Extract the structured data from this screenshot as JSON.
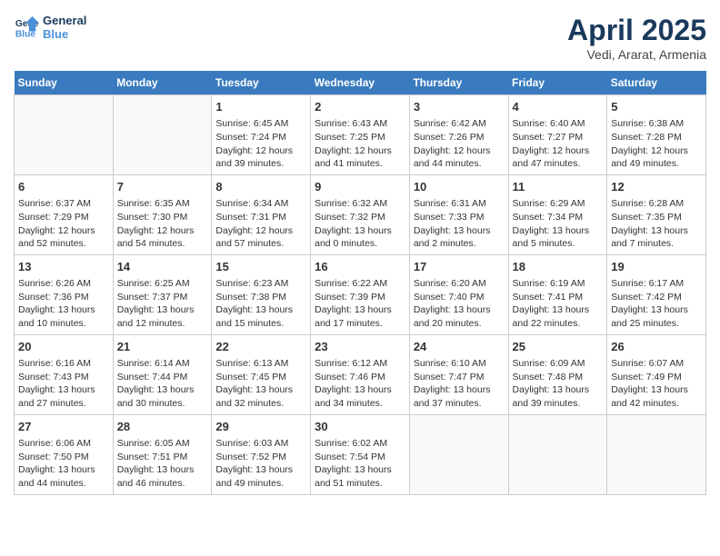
{
  "header": {
    "logo_line1": "General",
    "logo_line2": "Blue",
    "month_title": "April 2025",
    "location": "Vedi, Ararat, Armenia"
  },
  "days_of_week": [
    "Sunday",
    "Monday",
    "Tuesday",
    "Wednesday",
    "Thursday",
    "Friday",
    "Saturday"
  ],
  "weeks": [
    [
      {
        "num": "",
        "info": ""
      },
      {
        "num": "",
        "info": ""
      },
      {
        "num": "1",
        "info": "Sunrise: 6:45 AM\nSunset: 7:24 PM\nDaylight: 12 hours and 39 minutes."
      },
      {
        "num": "2",
        "info": "Sunrise: 6:43 AM\nSunset: 7:25 PM\nDaylight: 12 hours and 41 minutes."
      },
      {
        "num": "3",
        "info": "Sunrise: 6:42 AM\nSunset: 7:26 PM\nDaylight: 12 hours and 44 minutes."
      },
      {
        "num": "4",
        "info": "Sunrise: 6:40 AM\nSunset: 7:27 PM\nDaylight: 12 hours and 47 minutes."
      },
      {
        "num": "5",
        "info": "Sunrise: 6:38 AM\nSunset: 7:28 PM\nDaylight: 12 hours and 49 minutes."
      }
    ],
    [
      {
        "num": "6",
        "info": "Sunrise: 6:37 AM\nSunset: 7:29 PM\nDaylight: 12 hours and 52 minutes."
      },
      {
        "num": "7",
        "info": "Sunrise: 6:35 AM\nSunset: 7:30 PM\nDaylight: 12 hours and 54 minutes."
      },
      {
        "num": "8",
        "info": "Sunrise: 6:34 AM\nSunset: 7:31 PM\nDaylight: 12 hours and 57 minutes."
      },
      {
        "num": "9",
        "info": "Sunrise: 6:32 AM\nSunset: 7:32 PM\nDaylight: 13 hours and 0 minutes."
      },
      {
        "num": "10",
        "info": "Sunrise: 6:31 AM\nSunset: 7:33 PM\nDaylight: 13 hours and 2 minutes."
      },
      {
        "num": "11",
        "info": "Sunrise: 6:29 AM\nSunset: 7:34 PM\nDaylight: 13 hours and 5 minutes."
      },
      {
        "num": "12",
        "info": "Sunrise: 6:28 AM\nSunset: 7:35 PM\nDaylight: 13 hours and 7 minutes."
      }
    ],
    [
      {
        "num": "13",
        "info": "Sunrise: 6:26 AM\nSunset: 7:36 PM\nDaylight: 13 hours and 10 minutes."
      },
      {
        "num": "14",
        "info": "Sunrise: 6:25 AM\nSunset: 7:37 PM\nDaylight: 13 hours and 12 minutes."
      },
      {
        "num": "15",
        "info": "Sunrise: 6:23 AM\nSunset: 7:38 PM\nDaylight: 13 hours and 15 minutes."
      },
      {
        "num": "16",
        "info": "Sunrise: 6:22 AM\nSunset: 7:39 PM\nDaylight: 13 hours and 17 minutes."
      },
      {
        "num": "17",
        "info": "Sunrise: 6:20 AM\nSunset: 7:40 PM\nDaylight: 13 hours and 20 minutes."
      },
      {
        "num": "18",
        "info": "Sunrise: 6:19 AM\nSunset: 7:41 PM\nDaylight: 13 hours and 22 minutes."
      },
      {
        "num": "19",
        "info": "Sunrise: 6:17 AM\nSunset: 7:42 PM\nDaylight: 13 hours and 25 minutes."
      }
    ],
    [
      {
        "num": "20",
        "info": "Sunrise: 6:16 AM\nSunset: 7:43 PM\nDaylight: 13 hours and 27 minutes."
      },
      {
        "num": "21",
        "info": "Sunrise: 6:14 AM\nSunset: 7:44 PM\nDaylight: 13 hours and 30 minutes."
      },
      {
        "num": "22",
        "info": "Sunrise: 6:13 AM\nSunset: 7:45 PM\nDaylight: 13 hours and 32 minutes."
      },
      {
        "num": "23",
        "info": "Sunrise: 6:12 AM\nSunset: 7:46 PM\nDaylight: 13 hours and 34 minutes."
      },
      {
        "num": "24",
        "info": "Sunrise: 6:10 AM\nSunset: 7:47 PM\nDaylight: 13 hours and 37 minutes."
      },
      {
        "num": "25",
        "info": "Sunrise: 6:09 AM\nSunset: 7:48 PM\nDaylight: 13 hours and 39 minutes."
      },
      {
        "num": "26",
        "info": "Sunrise: 6:07 AM\nSunset: 7:49 PM\nDaylight: 13 hours and 42 minutes."
      }
    ],
    [
      {
        "num": "27",
        "info": "Sunrise: 6:06 AM\nSunset: 7:50 PM\nDaylight: 13 hours and 44 minutes."
      },
      {
        "num": "28",
        "info": "Sunrise: 6:05 AM\nSunset: 7:51 PM\nDaylight: 13 hours and 46 minutes."
      },
      {
        "num": "29",
        "info": "Sunrise: 6:03 AM\nSunset: 7:52 PM\nDaylight: 13 hours and 49 minutes."
      },
      {
        "num": "30",
        "info": "Sunrise: 6:02 AM\nSunset: 7:54 PM\nDaylight: 13 hours and 51 minutes."
      },
      {
        "num": "",
        "info": ""
      },
      {
        "num": "",
        "info": ""
      },
      {
        "num": "",
        "info": ""
      }
    ]
  ]
}
